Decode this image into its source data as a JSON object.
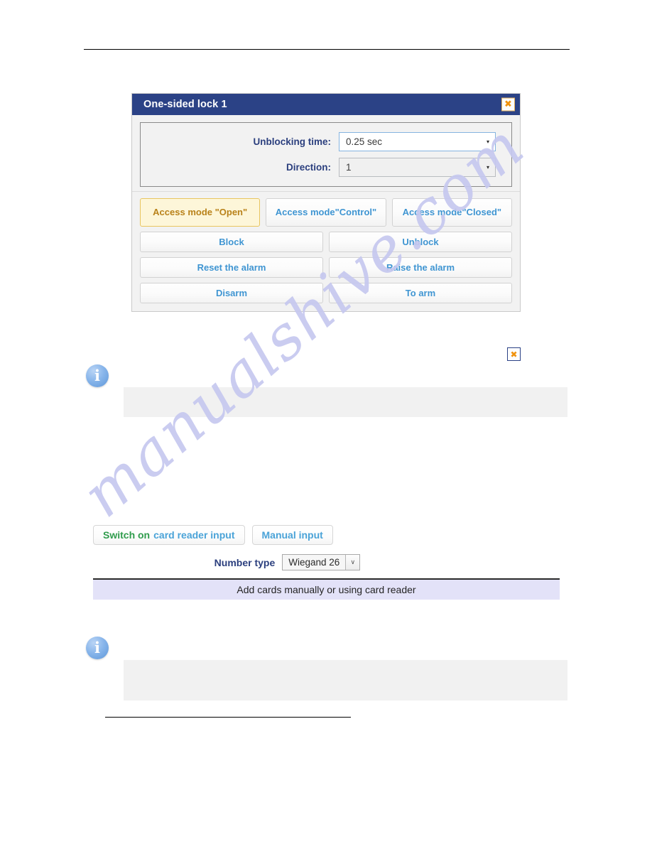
{
  "page": {
    "header_rule": true,
    "footer_rule": true,
    "watermark": "manualshive.com"
  },
  "dialog": {
    "title": "One-sided lock 1",
    "close_label": "✖",
    "close_icon_name": "close-icon",
    "fields": [
      {
        "label": "Unblocking time:",
        "value": "0.25 sec",
        "focused": true,
        "caret": "▾"
      },
      {
        "label": "Direction:",
        "value": "1",
        "focused": false,
        "caret": "▾"
      }
    ],
    "mode_buttons": [
      {
        "label": "Access mode \"Open\"",
        "active": true
      },
      {
        "label": "Access mode\n\"Control\"",
        "active": false
      },
      {
        "label": "Access mode\n\"Closed\"",
        "active": false
      }
    ],
    "action_rows": [
      {
        "left": "Block",
        "right": "Unblock"
      },
      {
        "left": "Reset the alarm",
        "right": "Raise the alarm"
      },
      {
        "left": "Disarm",
        "right": "To arm"
      }
    ],
    "colors": {
      "titlebar": "#2b4286",
      "accent_blue": "#3f95d2",
      "active_mode_bg": "#fdf6d9",
      "active_mode_border": "#e8c55f",
      "active_mode_text": "#b9821a"
    }
  },
  "notes": [
    {
      "icon": "info-icon",
      "text": ""
    },
    {
      "icon": "info-icon",
      "text": ""
    }
  ],
  "inline_close": {
    "label": "✖",
    "icon_name": "close-icon"
  },
  "card_reader": {
    "tabs": [
      {
        "prefix": "Switch on",
        "suffix": "card reader input",
        "two_tone": true
      },
      {
        "label": "Manual input",
        "two_tone": false
      }
    ],
    "number_type": {
      "label": "Number type",
      "value": "Wiegand 26",
      "arrow": "∨"
    },
    "banner": "Add cards manually or using card reader",
    "colors": {
      "green": "#2f9c4c",
      "blue": "#4aa3d8",
      "banner_bg": "#e3e2f8"
    }
  }
}
